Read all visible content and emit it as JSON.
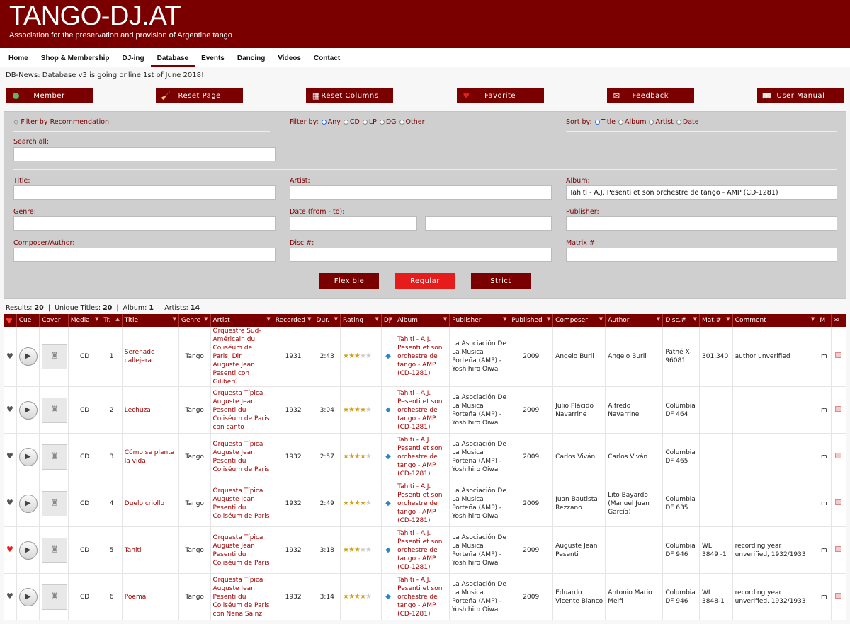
{
  "site": {
    "title": "TANGO-DJ.AT",
    "tagline": "Association for the preservation and provision of Argentine tango"
  },
  "nav": [
    "Home",
    "Shop & Membership",
    "DJ-ing",
    "Database",
    "Events",
    "Dancing",
    "Videos",
    "Contact"
  ],
  "nav_active": "Database",
  "news": "DB-News: Database v3 is going online 1st of June 2018!",
  "actions": {
    "member": "Member",
    "reset_page": "Reset Page",
    "reset_columns": "Reset Columns",
    "favorite": "Favorite",
    "feedback": "Feedback",
    "user_manual": "User Manual"
  },
  "filter": {
    "recommendation": "Filter by Recommendation",
    "filter_by_label": "Filter by:",
    "filter_options": [
      "Any",
      "CD",
      "LP",
      "DG",
      "Other"
    ],
    "filter_selected": "Any",
    "sort_by_label": "Sort by:",
    "sort_options": [
      "Title",
      "Album",
      "Artist",
      "Date"
    ],
    "sort_selected": "Title",
    "search_all": "Search all:",
    "title": "Title:",
    "artist": "Artist:",
    "album": "Album:",
    "album_value": "Tahiti - A.J. Pesenti et son orchestre de tango - AMP (CD-1281)",
    "genre": "Genre:",
    "date": "Date (from - to):",
    "publisher": "Publisher:",
    "composer": "Composer/Author:",
    "disc": "Disc #:",
    "matrix": "Matrix #:",
    "mode_buttons": [
      "Flexible",
      "Regular",
      "Strict"
    ],
    "mode_selected": "Regular"
  },
  "results": {
    "results_label": "Results:",
    "results": "20",
    "unique_label": "Unique Titles:",
    "unique": "20",
    "album_label": "Album:",
    "album": "1",
    "artists_label": "Artists:",
    "artists": "14"
  },
  "columns": [
    "",
    "Cue",
    "Cover",
    "Media",
    "Tr.",
    "Title",
    "Genre",
    "Artist",
    "Recorded",
    "Dur.",
    "Rating",
    "DJ",
    "Album",
    "Publisher",
    "Published",
    "Composer",
    "Author",
    "Disc.#",
    "Mat.#",
    "Comment",
    "M",
    ""
  ],
  "rows": [
    {
      "fav": false,
      "media": "CD",
      "track": "1",
      "title": "Serenade callejera",
      "genre": "Tango",
      "artist": "Orquestre Sud-Américain du Coliséum de Paris, Dir. Auguste Jean Pesenti con Giliberú",
      "recorded": "1931",
      "duration": "2:43",
      "rating": 3,
      "album": "Tahiti - A.J. Pesenti et son orchestre de tango - AMP (CD-1281)",
      "publisher": "La Asociación De La Musica Porteña (AMP) - Yoshihiro Oiwa",
      "published": "2009",
      "composer": "Angelo Burli",
      "author": "Angelo Burli",
      "disc": "Pathé X-96081",
      "matrix": "301.340",
      "comment": "author unverified",
      "m": "m"
    },
    {
      "fav": false,
      "media": "CD",
      "track": "2",
      "title": "Lechuza",
      "genre": "Tango",
      "artist": "Orquesta Típica Auguste Jean Pesenti du Coliséum de Paris con canto",
      "recorded": "1932",
      "duration": "3:04",
      "rating": 3.5,
      "album": "Tahiti - A.J. Pesenti et son orchestre de tango - AMP (CD-1281)",
      "publisher": "La Asociación De La Musica Porteña (AMP) - Yoshihiro Oiwa",
      "published": "2009",
      "composer": "Julio Plácido Navarrine",
      "author": "Alfredo Navarrine",
      "disc": "Columbia DF 464",
      "matrix": "",
      "comment": "",
      "m": "m"
    },
    {
      "fav": false,
      "media": "CD",
      "track": "3",
      "title": "Cómo se planta la vida",
      "genre": "Tango",
      "artist": "Orquesta Típica Auguste Jean Pesenti du Coliséum de Paris",
      "recorded": "1932",
      "duration": "2:57",
      "rating": 3.5,
      "album": "Tahiti - A.J. Pesenti et son orchestre de tango - AMP (CD-1281)",
      "publisher": "La Asociación De La Musica Porteña (AMP) - Yoshihiro Oiwa",
      "published": "2009",
      "composer": "Carlos Viván",
      "author": "Carlos Viván",
      "disc": "Columbia DF 465",
      "matrix": "",
      "comment": "",
      "m": "m"
    },
    {
      "fav": false,
      "media": "CD",
      "track": "4",
      "title": "Duelo criollo",
      "genre": "Tango",
      "artist": "Orquesta Típica Auguste Jean Pesenti du Coliséum de Paris",
      "recorded": "1932",
      "duration": "2:49",
      "rating": 3.5,
      "album": "Tahiti - A.J. Pesenti et son orchestre de tango - AMP (CD-1281)",
      "publisher": "La Asociación De La Musica Porteña (AMP) - Yoshihiro Oiwa",
      "published": "2009",
      "composer": "Juan Bautista Rezzano",
      "author": "Lito Bayardo (Manuel Juan García)",
      "disc": "Columbia DF 635",
      "matrix": "",
      "comment": "",
      "m": "m"
    },
    {
      "fav": true,
      "media": "CD",
      "track": "5",
      "title": "Tahiti",
      "genre": "Tango",
      "artist": "Orquesta Típica Auguste Jean Pesenti du Coliséum de Paris",
      "recorded": "1932",
      "duration": "3:18",
      "rating": 3,
      "album": "Tahiti - A.J. Pesenti et son orchestre de tango - AMP (CD-1281)",
      "publisher": "La Asociación De La Musica Porteña (AMP) - Yoshihiro Oiwa",
      "published": "2009",
      "composer": "Auguste Jean Pesenti",
      "author": "",
      "disc": "Columbia DF 946",
      "matrix": "WL 3849 -1",
      "comment": "recording year unverified, 1932/1933",
      "m": "m"
    },
    {
      "fav": false,
      "media": "CD",
      "track": "6",
      "title": "Poema",
      "genre": "Tango",
      "artist": "Orquesta Típica Auguste Jean Pesenti du Coliséum de Paris con Nena Sainz",
      "recorded": "1932",
      "duration": "3:14",
      "rating": 4,
      "album": "Tahiti - A.J. Pesenti et son orchestre de tango - AMP (CD-1281)",
      "publisher": "La Asociación De La Musica Porteña (AMP) - Yoshihiro Oiwa",
      "published": "2009",
      "composer": "Eduardo Vicente Bianco",
      "author": "Antonio Mario Melfi",
      "disc": "Columbia DF 946",
      "matrix": "WL 3848-1",
      "comment": "recording year unverified, 1932/1933",
      "m": "m"
    }
  ],
  "colors": {
    "brand": "#7a0000",
    "accent": "#e61c1c",
    "heart_on": "#e61c1c",
    "star": "#d4a017"
  }
}
